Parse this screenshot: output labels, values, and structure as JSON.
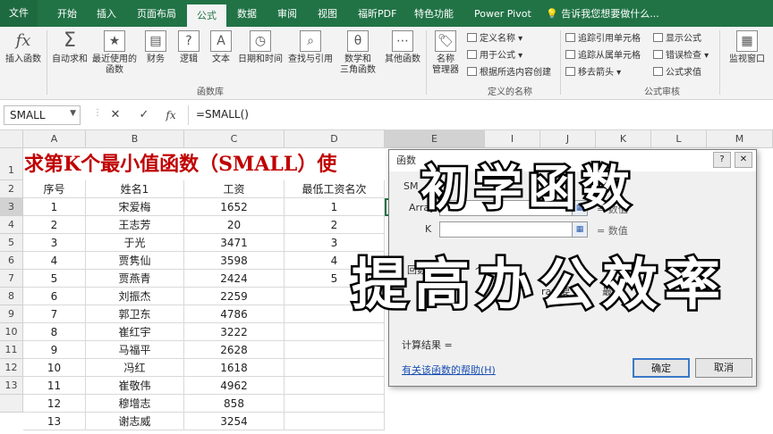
{
  "tabs": {
    "file": "文件",
    "items": [
      "开始",
      "插入",
      "页面布局",
      "公式",
      "数据",
      "审阅",
      "视图",
      "福昕PDF",
      "特色功能",
      "Power Pivot"
    ],
    "active": "公式",
    "tell_me": "告诉我您想要做什么..."
  },
  "ribbon": {
    "insert_function": "插入函数",
    "autosum": "自动求和",
    "recent": "最近使用的\n函数",
    "finance": "财务",
    "logic": "逻辑",
    "text": "文本",
    "datetime": "日期和时间",
    "lookup": "查找与引用",
    "math": "数学和\n三角函数",
    "other": "其他函数",
    "group_library": "函数库",
    "name_manager": "名称\n管理器",
    "define_name": "定义名称",
    "use_in_formula": "用于公式",
    "create_from_selection": "根据所选内容创建",
    "group_names": "定义的名称",
    "trace_precedents": "追踪引用单元格",
    "trace_dependents": "追踪从属单元格",
    "remove_arrows": "移去箭头",
    "show_formulas": "显示公式",
    "error_checking": "错误检查",
    "evaluate_formula": "公式求值",
    "group_audit": "公式审核",
    "watch_window": "监视窗口"
  },
  "formula_bar": {
    "name_box": "SMALL",
    "cancel": "✕",
    "enter": "✓",
    "fx": "fx",
    "formula": "=SMALL()"
  },
  "sheet": {
    "columns": [
      "A",
      "B",
      "C",
      "D",
      "E",
      "I",
      "J",
      "K",
      "L",
      "M"
    ],
    "row_numbers": [
      "1",
      "2",
      "3",
      "4",
      "5",
      "6",
      "7",
      "8",
      "9",
      "10",
      "11",
      "12",
      "13"
    ],
    "title": "求第K个最小值函数（SMALL）使",
    "headers": [
      "序号",
      "姓名1",
      "工资",
      "最低工资名次"
    ],
    "rows": [
      [
        "1",
        "宋爱梅",
        "1652",
        "1"
      ],
      [
        "2",
        "王志芳",
        "20",
        "2"
      ],
      [
        "3",
        "于光",
        "3471",
        "3"
      ],
      [
        "4",
        "贾隽仙",
        "3598",
        "4"
      ],
      [
        "5",
        "贾燕青",
        "2424",
        "5"
      ],
      [
        "6",
        "刘振杰",
        "2259",
        ""
      ],
      [
        "7",
        "郭卫东",
        "4786",
        ""
      ],
      [
        "8",
        "崔红宇",
        "3222",
        ""
      ],
      [
        "9",
        "马福平",
        "2628",
        ""
      ],
      [
        "10",
        "冯红",
        "1618",
        ""
      ],
      [
        "11",
        "崔敬伟",
        "4962",
        ""
      ],
      [
        "12",
        "穆增志",
        "858",
        ""
      ],
      [
        "13",
        "谢志威",
        "3254",
        ""
      ]
    ],
    "e3_partial": "="
  },
  "dialog": {
    "title": "函数",
    "func_name": "SM",
    "arg1_label": "Array",
    "arg1_result": "= 数值",
    "arg2_label": "K",
    "arg2_result": "= 数值",
    "desc_partial": "回数",
    "desc_partial2": "个最",
    "desc_partial3": "ray 要",
    "desc_partial4": "最小",
    "desc_partial5": "组",
    "calc_result": "计算结果 =",
    "help_link": "有关该函数的帮助(H)",
    "ok": "确定",
    "cancel": "取消"
  },
  "overlay": {
    "line1": "初学函数",
    "line2": "提高办公效率"
  }
}
